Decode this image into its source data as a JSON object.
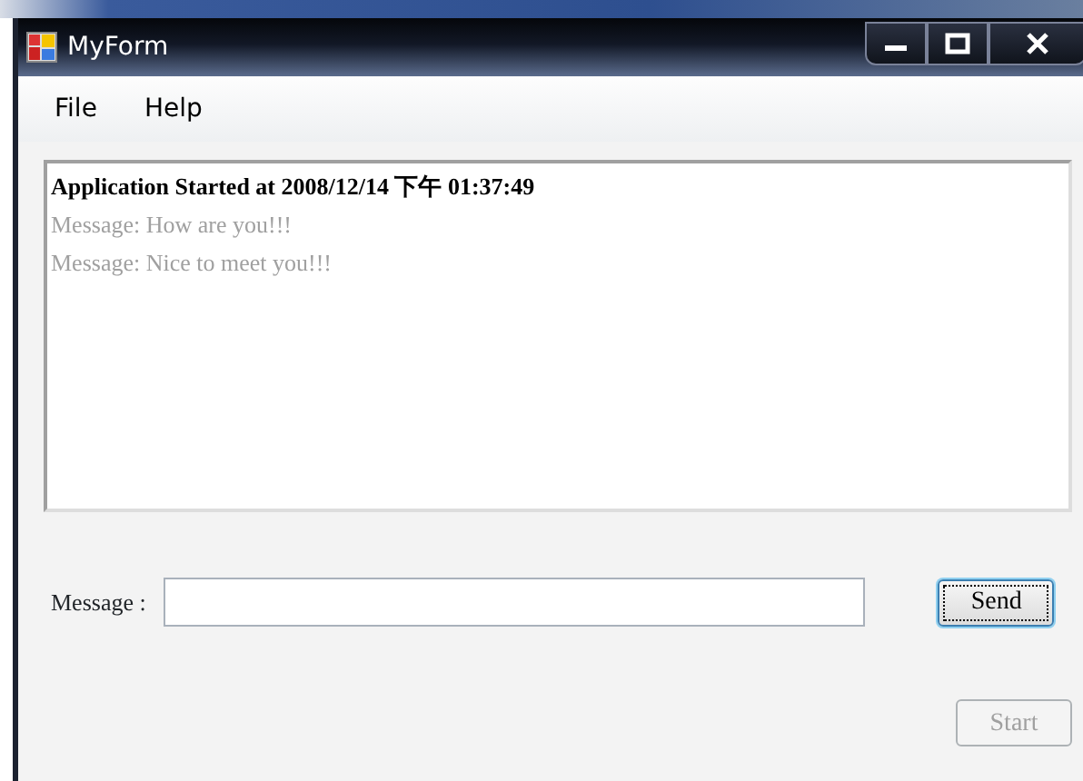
{
  "window": {
    "title": "MyForm"
  },
  "menu": [
    "File",
    "Help"
  ],
  "log": [
    {
      "kind": "header",
      "text": "Application Started at 2008/12/14 下午 01:37:49"
    },
    {
      "kind": "message",
      "text": "Message: How are you!!!"
    },
    {
      "kind": "message",
      "text": "Message: Nice to meet you!!!"
    }
  ],
  "message_row": {
    "label": "Message :"
  },
  "buttons": [
    {
      "label": "Send",
      "disabled": false,
      "focused": true
    },
    {
      "label": "Start",
      "disabled": true,
      "focused": false
    }
  ]
}
